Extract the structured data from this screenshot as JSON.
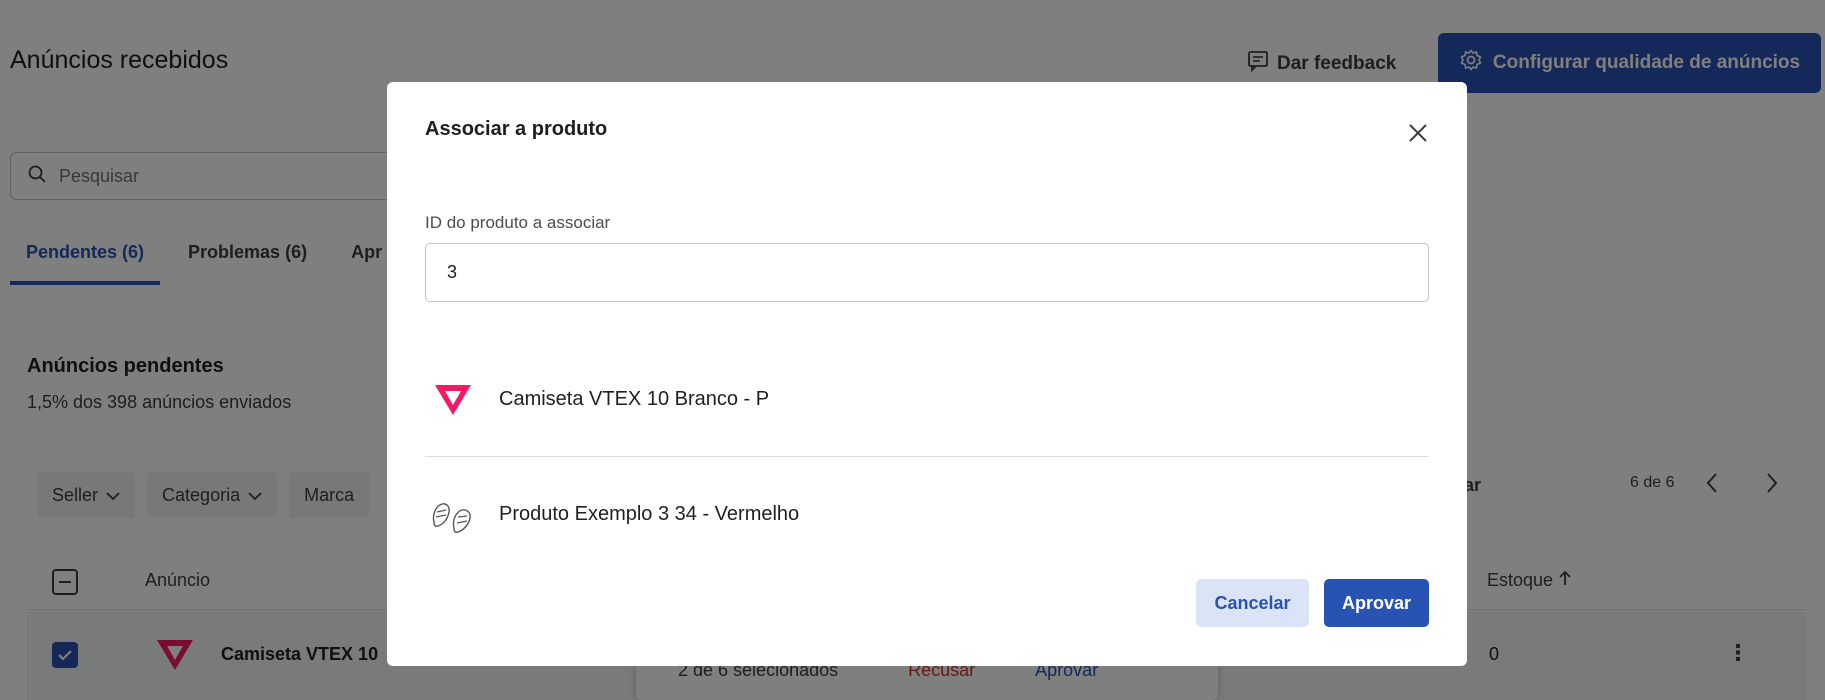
{
  "page": {
    "title": "Anúncios recebidos",
    "feedback_label": "Dar feedback",
    "config_label": "Configurar qualidade de anúncios",
    "search_placeholder": "Pesquisar",
    "tabs": [
      {
        "label": "Pendentes (6)",
        "active": true
      },
      {
        "label": "Problemas (6)",
        "active": false
      },
      {
        "label": "Apr",
        "active": false
      }
    ],
    "section_title": "Anúncios pendentes",
    "section_sub": "1,5% dos 398 anúncios enviados",
    "filters": [
      {
        "label": "Seller"
      },
      {
        "label": "Categoria"
      },
      {
        "label": "Marca"
      }
    ],
    "sort_label": "ortar",
    "pager_count": "6 de 6",
    "table": {
      "col_anuncio": "Anúncio",
      "col_estoque": "Estoque",
      "row_name": "Camiseta VTEX 10",
      "row_stock": "0"
    },
    "bulk": {
      "count": "2 de 6 selecionados",
      "refuse": "Recusar",
      "approve": "Aprovar"
    }
  },
  "modal": {
    "title": "Associar a produto",
    "field_label": "ID do produto a associar",
    "field_value": "3",
    "results": [
      {
        "name": "Camiseta VTEX 10 Branco - P",
        "thumb": "vtex-logo-icon"
      },
      {
        "name": "Produto Exemplo 3 34 - Vermelho",
        "thumb": "sandals-icon"
      }
    ],
    "cancel_label": "Cancelar",
    "approve_label": "Aprovar"
  },
  "colors": {
    "primary": "#2953b2",
    "vtex_pink": "#f71963",
    "danger": "#d32f2f",
    "overlay": "rgba(0,0,0,0.5)"
  }
}
